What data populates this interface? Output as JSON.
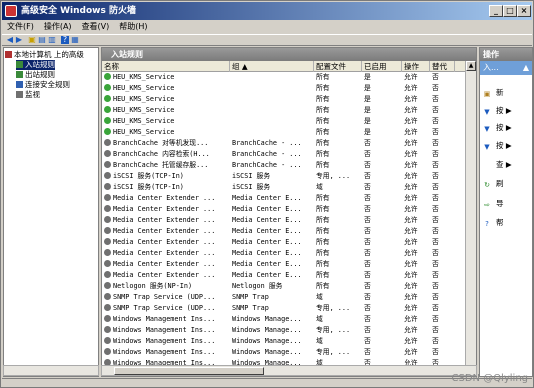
{
  "window": {
    "title": "高级安全 Windows 防火墙",
    "controls": [
      "_",
      "□",
      "×"
    ]
  },
  "menu": [
    "文件(F)",
    "操作(A)",
    "查看(V)",
    "帮助(H)"
  ],
  "tree": [
    {
      "label": "本地计算机 上的高级",
      "indent": 0,
      "icon": "firewall-icon",
      "sel": false,
      "name": "tree-root"
    },
    {
      "label": "入站规则",
      "indent": 1,
      "icon": "inbound-icon",
      "sel": true,
      "name": "tree-inbound"
    },
    {
      "label": "出站规则",
      "indent": 1,
      "icon": "outbound-icon",
      "sel": false,
      "name": "tree-outbound"
    },
    {
      "label": "连接安全规则",
      "indent": 1,
      "icon": "security-icon",
      "sel": false,
      "name": "tree-connsec"
    },
    {
      "label": "监视",
      "indent": 1,
      "icon": "monitor-icon",
      "sel": false,
      "name": "tree-monitor"
    }
  ],
  "center": {
    "title": "入站规则",
    "columns": [
      "名称",
      "组 ▲",
      "配置文件",
      "已启用",
      "操作",
      "替代"
    ]
  },
  "rules": [
    [
      "HEU_KMS_Service",
      "",
      "所有",
      "是",
      "允许",
      "否",
      true
    ],
    [
      "HEU_KMS_Service",
      "",
      "所有",
      "是",
      "允许",
      "否",
      true
    ],
    [
      "HEU_KMS_Service",
      "",
      "所有",
      "是",
      "允许",
      "否",
      true
    ],
    [
      "HEU_KMS_Service",
      "",
      "所有",
      "是",
      "允许",
      "否",
      true
    ],
    [
      "HEU_KMS_Service",
      "",
      "所有",
      "是",
      "允许",
      "否",
      true
    ],
    [
      "HEU_KMS_Service",
      "",
      "所有",
      "是",
      "允许",
      "否",
      true
    ],
    [
      "BranchCache 对等机发现...",
      "BranchCache - ...",
      "所有",
      "否",
      "允许",
      "否",
      false
    ],
    [
      "BranchCache 内容检索(H...",
      "BranchCache - ...",
      "所有",
      "否",
      "允许",
      "否",
      false
    ],
    [
      "BranchCache 托管缓存服...",
      "BranchCache - ...",
      "所有",
      "否",
      "允许",
      "否",
      false
    ],
    [
      "iSCSI 服务(TCP-In)",
      "iSCSI 服务",
      "专用, ...",
      "否",
      "允许",
      "否",
      false
    ],
    [
      "iSCSI 服务(TCP-In)",
      "iSCSI 服务",
      "域",
      "否",
      "允许",
      "否",
      false
    ],
    [
      "Media Center Extender ...",
      "Media Center E...",
      "所有",
      "否",
      "允许",
      "否",
      false
    ],
    [
      "Media Center Extender ...",
      "Media Center E...",
      "所有",
      "否",
      "允许",
      "否",
      false
    ],
    [
      "Media Center Extender ...",
      "Media Center E...",
      "所有",
      "否",
      "允许",
      "否",
      false
    ],
    [
      "Media Center Extender ...",
      "Media Center E...",
      "所有",
      "否",
      "允许",
      "否",
      false
    ],
    [
      "Media Center Extender ...",
      "Media Center E...",
      "所有",
      "否",
      "允许",
      "否",
      false
    ],
    [
      "Media Center Extender ...",
      "Media Center E...",
      "所有",
      "否",
      "允许",
      "否",
      false
    ],
    [
      "Media Center Extender ...",
      "Media Center E...",
      "所有",
      "否",
      "允许",
      "否",
      false
    ],
    [
      "Media Center Extender ...",
      "Media Center E...",
      "所有",
      "否",
      "允许",
      "否",
      false
    ],
    [
      "Netlogon 服务(NP-In)",
      "Netlogon 服务",
      "所有",
      "否",
      "允许",
      "否",
      false
    ],
    [
      "SNMP Trap Service (UDP...",
      "SNMP Trap",
      "域",
      "否",
      "允许",
      "否",
      false
    ],
    [
      "SNMP Trap Service (UDP...",
      "SNMP Trap",
      "专用, ...",
      "否",
      "允许",
      "否",
      false
    ],
    [
      "Windows Management Ins...",
      "Windows Manage...",
      "域",
      "否",
      "允许",
      "否",
      false
    ],
    [
      "Windows Management Ins...",
      "Windows Manage...",
      "专用, ...",
      "否",
      "允许",
      "否",
      false
    ],
    [
      "Windows Management Ins...",
      "Windows Manage...",
      "域",
      "否",
      "允许",
      "否",
      false
    ],
    [
      "Windows Management Ins...",
      "Windows Manage...",
      "专用, ...",
      "否",
      "允许",
      "否",
      false
    ],
    [
      "Windows Management Ins...",
      "Windows Manage...",
      "域",
      "否",
      "允许",
      "否",
      false
    ]
  ],
  "actions": {
    "title": "操作",
    "section": "入...",
    "items": [
      {
        "label": "新",
        "icon": "new-rule-icon",
        "glyph": "▣"
      },
      {
        "label": "按 ▶",
        "icon": "filter-icon",
        "glyph": "▼"
      },
      {
        "label": "按 ▶",
        "icon": "filter-icon",
        "glyph": "▼"
      },
      {
        "label": "按 ▶",
        "icon": "filter-icon",
        "glyph": "▼"
      },
      {
        "label": "查 ▶",
        "icon": "view-icon",
        "glyph": ""
      },
      {
        "label": "刷",
        "icon": "refresh-icon",
        "glyph": "↻"
      },
      {
        "label": "导",
        "icon": "export-icon",
        "glyph": "⇨"
      },
      {
        "label": "帮",
        "icon": "help-icon",
        "glyph": "?"
      }
    ]
  },
  "watermark": "CSDN @Qlyling"
}
